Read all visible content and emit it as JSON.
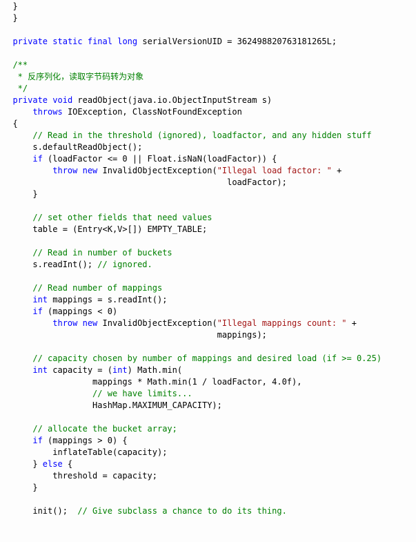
{
  "code_tokens": [
    [
      {
        "t": "  }",
        "c": ""
      }
    ],
    [
      {
        "t": "  }",
        "c": ""
      }
    ],
    [
      {
        "t": "",
        "c": ""
      }
    ],
    [
      {
        "t": "  ",
        "c": ""
      },
      {
        "t": "private",
        "c": "kw"
      },
      {
        "t": " ",
        "c": ""
      },
      {
        "t": "static",
        "c": "kw"
      },
      {
        "t": " ",
        "c": ""
      },
      {
        "t": "final",
        "c": "kw"
      },
      {
        "t": " ",
        "c": ""
      },
      {
        "t": "long",
        "c": "kw"
      },
      {
        "t": " serialVersionUID = 362498820763181265L;",
        "c": ""
      }
    ],
    [
      {
        "t": "",
        "c": ""
      }
    ],
    [
      {
        "t": "  ",
        "c": ""
      },
      {
        "t": "/**",
        "c": "cmt"
      }
    ],
    [
      {
        "t": "   * 反序列化，读取字节码转为对象",
        "c": "cmt"
      }
    ],
    [
      {
        "t": "   */",
        "c": "cmt"
      }
    ],
    [
      {
        "t": "  ",
        "c": ""
      },
      {
        "t": "private",
        "c": "kw"
      },
      {
        "t": " ",
        "c": ""
      },
      {
        "t": "void",
        "c": "kw"
      },
      {
        "t": " readObject(java.io.ObjectInputStream s)",
        "c": ""
      }
    ],
    [
      {
        "t": "      ",
        "c": ""
      },
      {
        "t": "throws",
        "c": "kw"
      },
      {
        "t": " IOException, ClassNotFoundException",
        "c": ""
      }
    ],
    [
      {
        "t": "  {",
        "c": ""
      }
    ],
    [
      {
        "t": "      ",
        "c": ""
      },
      {
        "t": "// Read in the threshold (ignored), loadfactor, and any hidden stuff",
        "c": "cmt"
      }
    ],
    [
      {
        "t": "      s.defaultReadObject();",
        "c": ""
      }
    ],
    [
      {
        "t": "      ",
        "c": ""
      },
      {
        "t": "if",
        "c": "kw"
      },
      {
        "t": " (loadFactor <= 0 || Float.isNaN(loadFactor)) {",
        "c": ""
      }
    ],
    [
      {
        "t": "          ",
        "c": ""
      },
      {
        "t": "throw",
        "c": "kw"
      },
      {
        "t": " ",
        "c": ""
      },
      {
        "t": "new",
        "c": "kw"
      },
      {
        "t": " InvalidObjectException(",
        "c": ""
      },
      {
        "t": "\"Illegal load factor: \"",
        "c": "str"
      },
      {
        "t": " +",
        "c": ""
      }
    ],
    [
      {
        "t": "                                             loadFactor);",
        "c": ""
      }
    ],
    [
      {
        "t": "      }",
        "c": ""
      }
    ],
    [
      {
        "t": "",
        "c": ""
      }
    ],
    [
      {
        "t": "      ",
        "c": ""
      },
      {
        "t": "// set other fields that need values",
        "c": "cmt"
      }
    ],
    [
      {
        "t": "      table = (Entry<K,V>[]) EMPTY_TABLE;",
        "c": ""
      }
    ],
    [
      {
        "t": "",
        "c": ""
      }
    ],
    [
      {
        "t": "      ",
        "c": ""
      },
      {
        "t": "// Read in number of buckets",
        "c": "cmt"
      }
    ],
    [
      {
        "t": "      s.readInt(); ",
        "c": ""
      },
      {
        "t": "// ignored.",
        "c": "cmt"
      }
    ],
    [
      {
        "t": "",
        "c": ""
      }
    ],
    [
      {
        "t": "      ",
        "c": ""
      },
      {
        "t": "// Read number of mappings",
        "c": "cmt"
      }
    ],
    [
      {
        "t": "      ",
        "c": ""
      },
      {
        "t": "int",
        "c": "kw"
      },
      {
        "t": " mappings = s.readInt();",
        "c": ""
      }
    ],
    [
      {
        "t": "      ",
        "c": ""
      },
      {
        "t": "if",
        "c": "kw"
      },
      {
        "t": " (mappings < 0)",
        "c": ""
      }
    ],
    [
      {
        "t": "          ",
        "c": ""
      },
      {
        "t": "throw",
        "c": "kw"
      },
      {
        "t": " ",
        "c": ""
      },
      {
        "t": "new",
        "c": "kw"
      },
      {
        "t": " InvalidObjectException(",
        "c": ""
      },
      {
        "t": "\"Illegal mappings count: \"",
        "c": "str"
      },
      {
        "t": " +",
        "c": ""
      }
    ],
    [
      {
        "t": "                                           mappings);",
        "c": ""
      }
    ],
    [
      {
        "t": "",
        "c": ""
      }
    ],
    [
      {
        "t": "      ",
        "c": ""
      },
      {
        "t": "// capacity chosen by number of mappings and desired load (if >= 0.25)",
        "c": "cmt"
      }
    ],
    [
      {
        "t": "      ",
        "c": ""
      },
      {
        "t": "int",
        "c": "kw"
      },
      {
        "t": " capacity = (",
        "c": ""
      },
      {
        "t": "int",
        "c": "kw"
      },
      {
        "t": ") Math.min(",
        "c": ""
      }
    ],
    [
      {
        "t": "                  mappings * Math.min(1 / loadFactor, 4.0f),",
        "c": ""
      }
    ],
    [
      {
        "t": "                  ",
        "c": ""
      },
      {
        "t": "// we have limits...",
        "c": "cmt"
      }
    ],
    [
      {
        "t": "                  HashMap.MAXIMUM_CAPACITY);",
        "c": ""
      }
    ],
    [
      {
        "t": "",
        "c": ""
      }
    ],
    [
      {
        "t": "      ",
        "c": ""
      },
      {
        "t": "// allocate the bucket array;",
        "c": "cmt"
      }
    ],
    [
      {
        "t": "      ",
        "c": ""
      },
      {
        "t": "if",
        "c": "kw"
      },
      {
        "t": " (mappings > 0) {",
        "c": ""
      }
    ],
    [
      {
        "t": "          inflateTable(capacity);",
        "c": ""
      }
    ],
    [
      {
        "t": "      } ",
        "c": ""
      },
      {
        "t": "else",
        "c": "kw"
      },
      {
        "t": " {",
        "c": ""
      }
    ],
    [
      {
        "t": "          threshold = capacity;",
        "c": ""
      }
    ],
    [
      {
        "t": "      }",
        "c": ""
      }
    ],
    [
      {
        "t": "",
        "c": ""
      }
    ],
    [
      {
        "t": "      init();  ",
        "c": ""
      },
      {
        "t": "// Give subclass a chance to do its thing.",
        "c": "cmt"
      }
    ]
  ]
}
